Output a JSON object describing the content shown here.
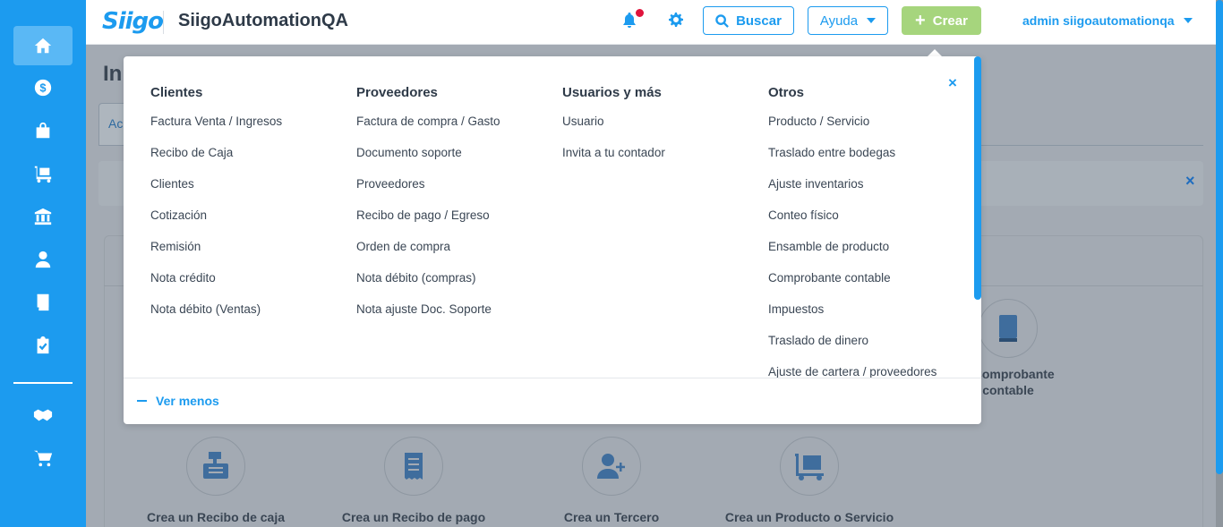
{
  "header": {
    "logo_text": "Siigo",
    "company": "SiigoAutomationQA",
    "search_label": "Buscar",
    "help_label": "Ayuda",
    "create_label": "Crear",
    "user_label": "admin siigoautomationqa"
  },
  "sidebar": {
    "items": [
      {
        "icon": "home-icon"
      },
      {
        "icon": "dollar-icon"
      },
      {
        "icon": "shopping-bag-icon"
      },
      {
        "icon": "cart-dolly-icon"
      },
      {
        "icon": "bank-icon"
      },
      {
        "icon": "employee-icon"
      },
      {
        "icon": "book-icon"
      },
      {
        "icon": "clipboard-check-icon"
      },
      {
        "icon": "handshake-icon"
      },
      {
        "icon": "shopping-cart-icon"
      }
    ]
  },
  "page": {
    "title": "In",
    "tab_label": "Ac",
    "actions": [
      {
        "label": "Crea un Recibo de caja",
        "icon": "cash-register-icon"
      },
      {
        "label": "Crea un Recibo de pago",
        "icon": "receipt-icon"
      },
      {
        "label": "Crea un Tercero",
        "icon": "add-user-icon"
      },
      {
        "label": "Crea un Producto o Servicio",
        "icon": "dolly-box-icon"
      },
      {
        "label": "n Comprobante",
        "label2": "contable",
        "icon": "book-icon"
      }
    ]
  },
  "menu": {
    "columns": [
      {
        "title": "Clientes",
        "items": [
          "Factura Venta / Ingresos",
          "Recibo de Caja",
          "Clientes",
          "Cotización",
          "Remisión",
          "Nota crédito",
          "Nota débito (Ventas)"
        ]
      },
      {
        "title": "Proveedores",
        "items": [
          "Factura de compra / Gasto",
          "Documento soporte",
          "Proveedores",
          "Recibo de pago / Egreso",
          "Orden de compra",
          "Nota débito (compras)",
          "Nota ajuste Doc. Soporte"
        ]
      },
      {
        "title": "Usuarios y más",
        "items": [
          "Usuario",
          "Invita a tu contador"
        ]
      },
      {
        "title": "Otros",
        "items": [
          "Producto / Servicio",
          "Traslado entre bodegas",
          "Ajuste inventarios",
          "Conteo físico",
          "Ensamble de producto",
          "Comprobante contable",
          "Impuestos",
          "Traslado de dinero",
          "Ajuste de cartera / proveedores"
        ]
      }
    ],
    "close_icon": "×",
    "footer_label": "Ver menos"
  },
  "colors": {
    "primary": "#1c9bef",
    "create_button": "#a6d57d",
    "notification_dot": "#e0143c"
  }
}
